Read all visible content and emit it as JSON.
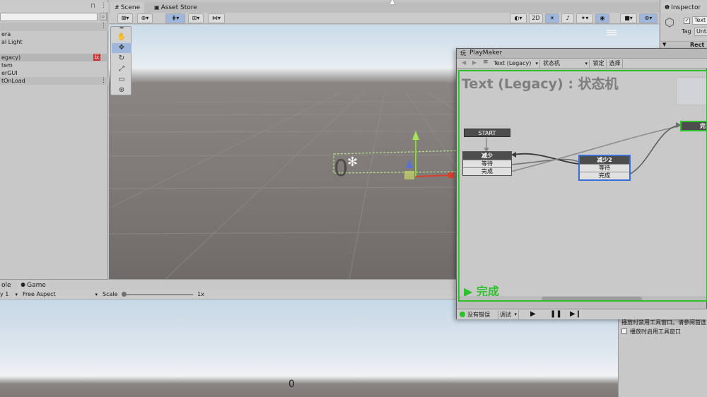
{
  "hierarchy": {
    "items": [
      "era",
      "al Light",
      "egacy)",
      "tem",
      "erGUI",
      "tOnLoad"
    ],
    "playmaker_badge": "玩"
  },
  "scene": {
    "tabs": [
      "Scene",
      "Asset Store"
    ],
    "toggle_2d": "2D",
    "text_object": "0"
  },
  "inspector": {
    "tab": "Inspector",
    "name_value": "Text",
    "tag_label": "Tag",
    "tag_value": "Unta",
    "component": "Rect T",
    "note": "播放时禁用工具窗口。请参阅首选",
    "checkbox_label": "播放时启用工具窗口"
  },
  "game": {
    "tabs": [
      "ole",
      "Game"
    ],
    "display": "y 1",
    "aspect": "Free Aspect",
    "scale_label": "Scale",
    "scale_value": "1x",
    "score": "0"
  },
  "playmaker": {
    "title": "PlayMaker",
    "title_icon": "玩",
    "selected_object": "Text (Legacy)",
    "fsm": "状态机",
    "lock_btn": "锁定",
    "select_btn": "选择",
    "graph_title": "Text (Legacy) : 状态机",
    "start_label": "START",
    "states": [
      {
        "name": "减少",
        "events": [
          "等待",
          "完成"
        ]
      },
      {
        "name": "减少2",
        "events": [
          "等待",
          "完成"
        ]
      },
      {
        "name": "完"
      }
    ],
    "active_state": "▶ 完成",
    "status": "没有错误",
    "debug": "调试",
    "colors": {
      "active_green": "#2ec12e",
      "selected_blue": "#3a6fd8",
      "header_dark": "#4d4d4d"
    }
  }
}
